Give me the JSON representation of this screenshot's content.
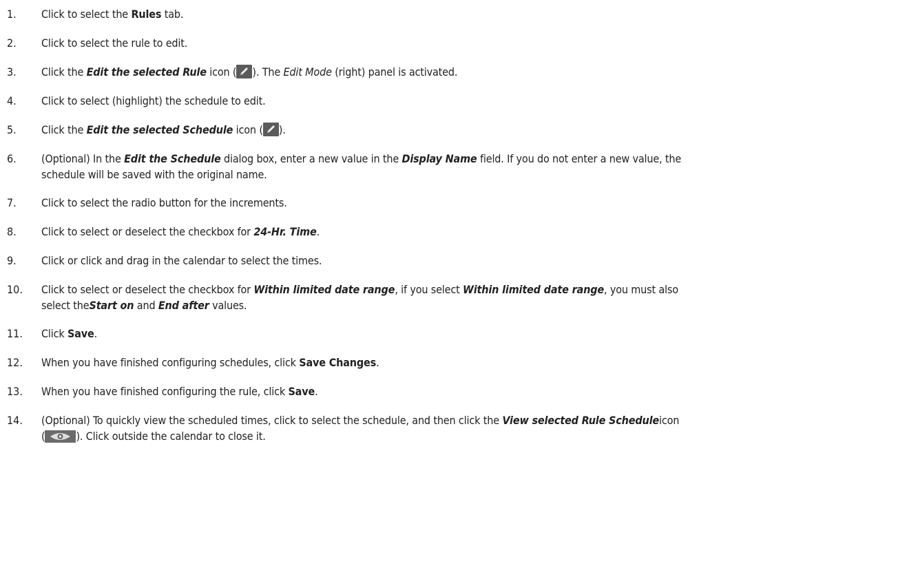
{
  "steps": [
    {
      "num": "1.",
      "parts": [
        "Click to select the ",
        "Rules",
        " tab."
      ]
    },
    {
      "num": "2.",
      "parts": [
        "Click to select the rule to edit."
      ]
    },
    {
      "num": "3.",
      "parts": [
        "Click the ",
        "Edit the selected Rule",
        " icon (",
        "). The ",
        "Edit Mode",
        " (right) panel is activated."
      ]
    },
    {
      "num": "4.",
      "parts": [
        "Click to select (highlight) the schedule to edit."
      ]
    },
    {
      "num": "5.",
      "parts": [
        "Click the ",
        "Edit the selected Schedule",
        " icon (",
        ")."
      ]
    },
    {
      "num": "6.",
      "parts": [
        "(Optional) In the ",
        "Edit the Schedule",
        " dialog box, enter a new value in the ",
        "Display Name",
        " field. If you do not enter a new value, the",
        "schedule will be saved with the original name."
      ]
    },
    {
      "num": "7.",
      "parts": [
        "Click to select the radio button for the increments."
      ]
    },
    {
      "num": "8.",
      "parts": [
        "Click to select or deselect the checkbox for ",
        "24-Hr. Time",
        "."
      ]
    },
    {
      "num": "9.",
      "parts": [
        "Click or click and drag in the calendar to select the times."
      ]
    },
    {
      "num": "10.",
      "parts": [
        "Click to select or deselect the checkbox for ",
        "Within limited date range",
        ", if you select ",
        "Within limited date range",
        ", you must also",
        "select the",
        "Start on",
        " and ",
        "End after",
        " values."
      ]
    },
    {
      "num": "11.",
      "parts": [
        "Click ",
        "Save",
        "."
      ]
    },
    {
      "num": "12.",
      "parts": [
        "When you have finished configuring schedules, click ",
        "Save Changes",
        "."
      ]
    },
    {
      "num": "13.",
      "parts": [
        "When you have finished configuring the rule, click ",
        "Save",
        "."
      ]
    },
    {
      "num": "14.",
      "parts": [
        "(Optional) To quickly view the scheduled times, click to select the schedule, and then click the ",
        "View selected Rule Schedule",
        "icon",
        "(",
        "). Click outside the calendar to close it."
      ]
    }
  ],
  "icons": {
    "edit": "pencil-icon",
    "view": "eye-icon",
    "icon_bg": "#5b5b5b"
  }
}
